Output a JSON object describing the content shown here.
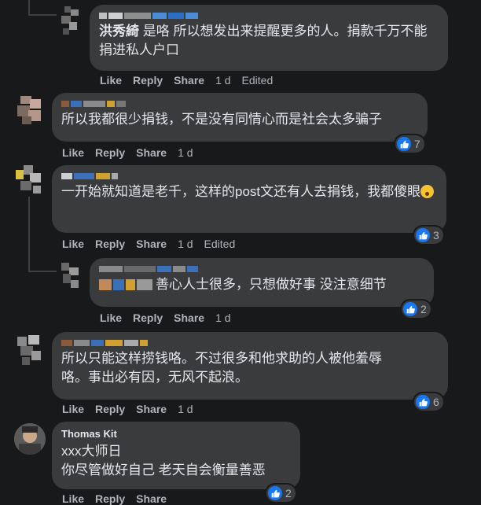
{
  "actions": {
    "like": "Like",
    "reply": "Reply",
    "share": "Share",
    "edited": "Edited"
  },
  "comments": [
    {
      "author": "洪秀綺",
      "text": "是咯 所以想发出来提醒更多的人。捐款千万不能捐进私人户口",
      "time": "1 d",
      "edited": true
    },
    {
      "text": "所以我都很少捐钱，不是没有同情心而是社会太多骗子",
      "time": "1 d",
      "reactions": "7"
    },
    {
      "text": "一开始就知道是老千，这样的post文还有人去捐钱，我都傻眼",
      "time": "1 d",
      "edited": true,
      "reactions": "3"
    },
    {
      "text": "善心人士很多，只想做好事 没注意细节",
      "time": "1 d",
      "reactions": "2"
    },
    {
      "text_line1": "所以只能这样捞钱咯。不过很多和他求助的人被他羞辱",
      "text_line2": "咯。事出必有因，无风不起浪。",
      "time": "1 d",
      "reactions": "6"
    },
    {
      "author": "Thomas Kit",
      "text_line1": "xxx大师日",
      "text_line2": "你尽管做好自己 老天自会衡量善恶",
      "reactions": "2"
    }
  ],
  "colors": {
    "like_blue": "#1877f2",
    "bubble": "#3a3b3c",
    "background": "#18191a"
  }
}
